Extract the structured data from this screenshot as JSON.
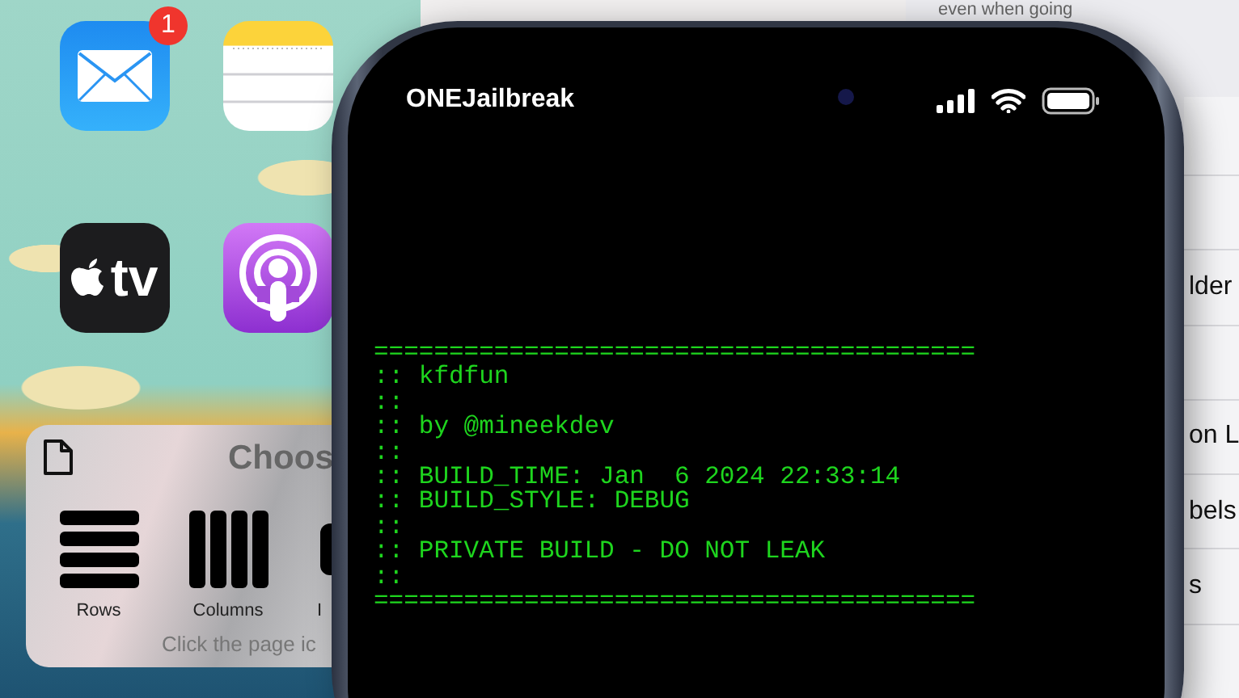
{
  "home_screen": {
    "apps": [
      {
        "kind": "mail",
        "badge": "1"
      },
      {
        "kind": "notes"
      },
      {
        "kind": "tv",
        "label": "tv"
      },
      {
        "kind": "podcasts"
      }
    ],
    "chooser": {
      "title": "Choos",
      "options": [
        {
          "kind": "rows",
          "label": "Rows"
        },
        {
          "kind": "columns",
          "label": "Columns"
        },
        {
          "kind": "icons",
          "label": "I"
        }
      ],
      "hint": "Click the page ic"
    }
  },
  "background_window": {
    "caption": "even when going",
    "items": [
      "lder",
      "on L",
      "bels",
      "s"
    ]
  },
  "phone": {
    "status_bar": {
      "title": "ONEJailbreak"
    },
    "terminal": {
      "lines": [
        "========================================",
        ":: kfdfun",
        "::",
        ":: by @mineekdev",
        "::",
        ":: BUILD_TIME: Jan  6 2024 22:33:14",
        ":: BUILD_STYLE: DEBUG",
        "::",
        ":: PRIVATE BUILD - DO NOT LEAK",
        "::",
        "========================================"
      ]
    }
  }
}
